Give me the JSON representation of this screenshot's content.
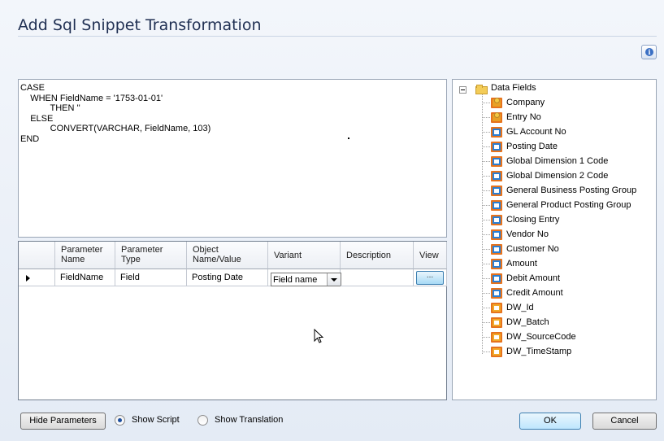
{
  "window": {
    "title": "Add Sql Snippet Transformation"
  },
  "editor": {
    "script": "CASE\n    WHEN FieldName = '1753-01-01'\n            THEN ''\n    ELSE\n            CONVERT(VARCHAR, FieldName, 103)\nEND"
  },
  "grid": {
    "columns": [
      "Parameter\nName",
      "Parameter\nType",
      "Object\nName/Value",
      "Variant",
      "Description",
      "View"
    ],
    "rows": [
      {
        "name": "FieldName",
        "type": "Field",
        "value": "Posting Date",
        "variant": "Field name",
        "description": "",
        "view": "..."
      }
    ]
  },
  "tree": {
    "root": "Data Fields",
    "items": [
      {
        "label": "Company",
        "icon": "key-field-icon"
      },
      {
        "label": "Entry No",
        "icon": "key-field-icon"
      },
      {
        "label": "GL Account No",
        "icon": "field-icon"
      },
      {
        "label": "Posting Date",
        "icon": "field-icon"
      },
      {
        "label": "Global Dimension 1 Code",
        "icon": "field-icon"
      },
      {
        "label": "Global Dimension 2 Code",
        "icon": "field-icon"
      },
      {
        "label": "General Business Posting Group",
        "icon": "field-icon"
      },
      {
        "label": "General Product Posting Group",
        "icon": "field-icon"
      },
      {
        "label": "Closing Entry",
        "icon": "field-icon"
      },
      {
        "label": "Vendor No",
        "icon": "field-icon"
      },
      {
        "label": "Customer No",
        "icon": "field-icon"
      },
      {
        "label": "Amount",
        "icon": "field-icon"
      },
      {
        "label": "Debit Amount",
        "icon": "field-icon"
      },
      {
        "label": "Credit Amount",
        "icon": "field-icon"
      },
      {
        "label": "DW_Id",
        "icon": "dw-field-icon"
      },
      {
        "label": "DW_Batch",
        "icon": "dw-field-icon"
      },
      {
        "label": "DW_SourceCode",
        "icon": "dw-field-icon"
      },
      {
        "label": "DW_TimeStamp",
        "icon": "dw-field-icon"
      }
    ]
  },
  "footer": {
    "hide_parameters": "Hide Parameters",
    "show_script": "Show Script",
    "show_translation": "Show Translation",
    "ok": "OK",
    "cancel": "Cancel",
    "selected_view": "Show Script"
  }
}
